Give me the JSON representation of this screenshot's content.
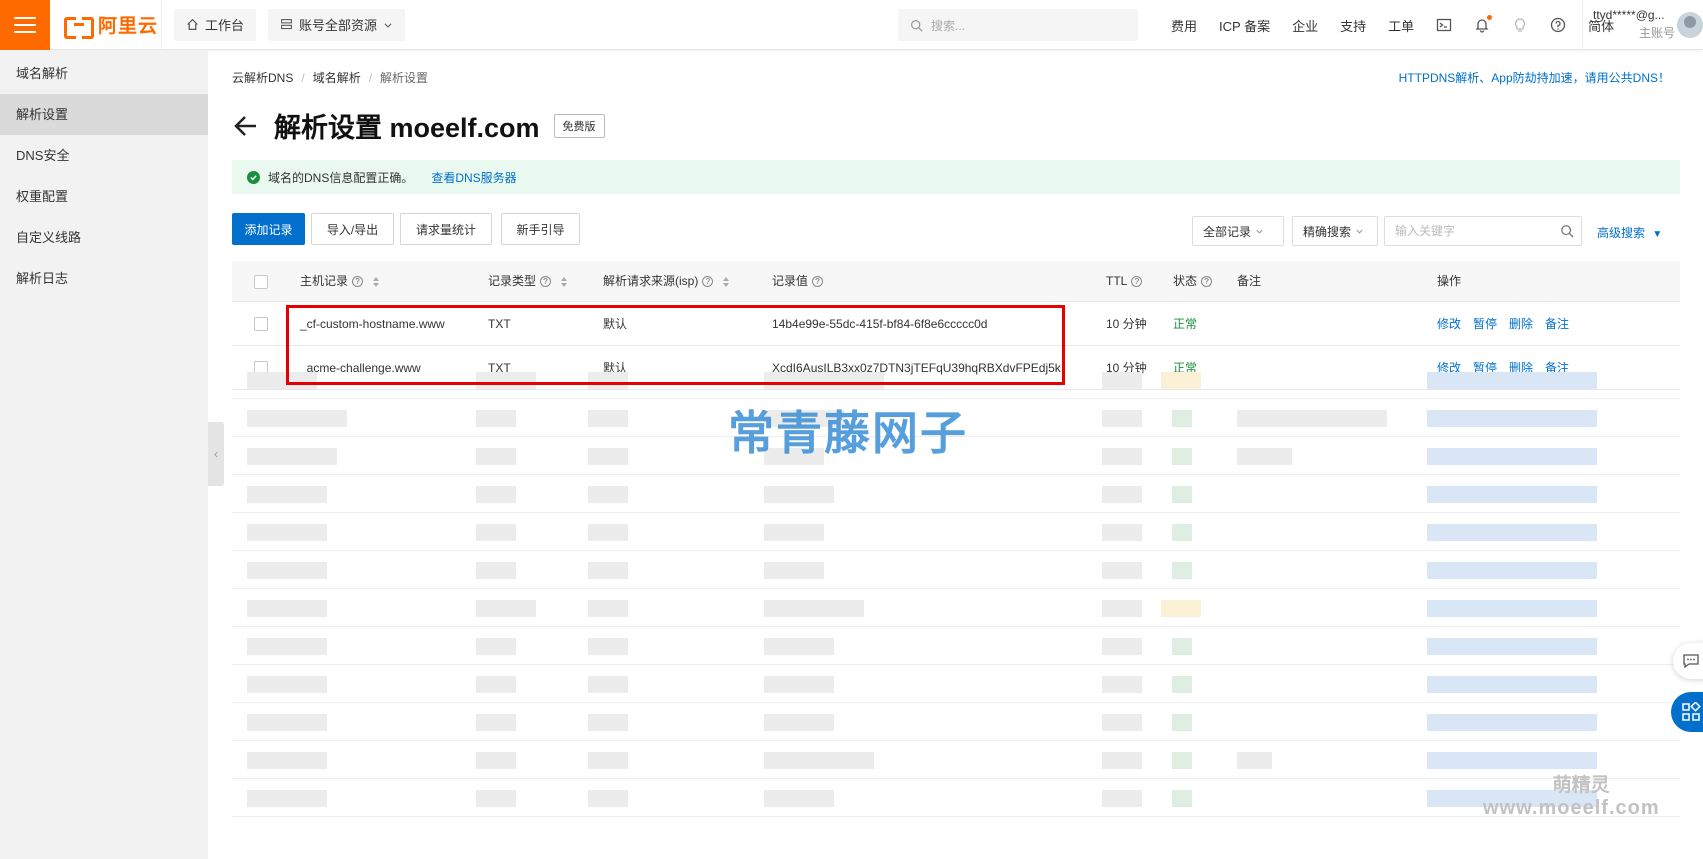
{
  "topbar": {
    "logo_text": "阿里云",
    "workbench_label": "工作台",
    "resources_label": "账号全部资源",
    "search_placeholder": "搜索...",
    "links": [
      "费用",
      "ICP 备案",
      "企业",
      "支持",
      "工单"
    ],
    "lang_label": "简体",
    "account_name": "ttyd*****@g...",
    "account_type": "主账号",
    "accent_color": "#ff6a00"
  },
  "sidebar": {
    "items": [
      {
        "label": "域名解析"
      },
      {
        "label": "解析设置"
      },
      {
        "label": "DNS安全"
      },
      {
        "label": "权重配置"
      },
      {
        "label": "自定义线路"
      },
      {
        "label": "解析日志"
      }
    ],
    "active_index": 1
  },
  "breadcrumb": [
    "云解析DNS",
    "域名解析",
    "解析设置"
  ],
  "promo_link": "HTTPDNS解析、App防劫持加速，请用公共DNS！",
  "page": {
    "title": "解析设置 moeelf.com",
    "edition_badge": "免费版"
  },
  "notice": {
    "text": "域名的DNS信息配置正确。",
    "link": "查看DNS服务器"
  },
  "toolbar": {
    "add_record": "添加记录",
    "import_export": "导入/导出",
    "request_stats": "请求量统计",
    "guide": "新手引导",
    "filter_all": "全部记录",
    "search_mode": "精确搜索",
    "keyword_placeholder": "输入关键字",
    "advanced_search": "高级搜索"
  },
  "table": {
    "columns": [
      "主机记录",
      "记录类型",
      "解析请求来源(isp)",
      "记录值",
      "TTL",
      "状态",
      "备注",
      "操作"
    ],
    "rows": [
      {
        "host": "_cf-custom-hostname.www",
        "type": "TXT",
        "line": "默认",
        "value": "14b4e99e-55dc-415f-bf84-6f8e6ccccc0d",
        "ttl": "10 分钟",
        "status": "正常",
        "note": ""
      },
      {
        "host": "_acme-challenge.www",
        "type": "TXT",
        "line": "默认",
        "value": "XcdI6AusILB3xx0z7DTN3jTEFqU39hqRBXdvFPEdj5k",
        "ttl": "10 分钟",
        "status": "正常",
        "note": ""
      }
    ],
    "actions": [
      "修改",
      "暂停",
      "删除",
      "备注"
    ]
  },
  "watermark": {
    "main": "常青藤网子",
    "corner_name": "萌精灵",
    "corner_url": "www.moeelf.com"
  },
  "colors": {
    "primary": "#0070cc",
    "success": "#1e8e3e",
    "highlight_box": "#e60000"
  }
}
